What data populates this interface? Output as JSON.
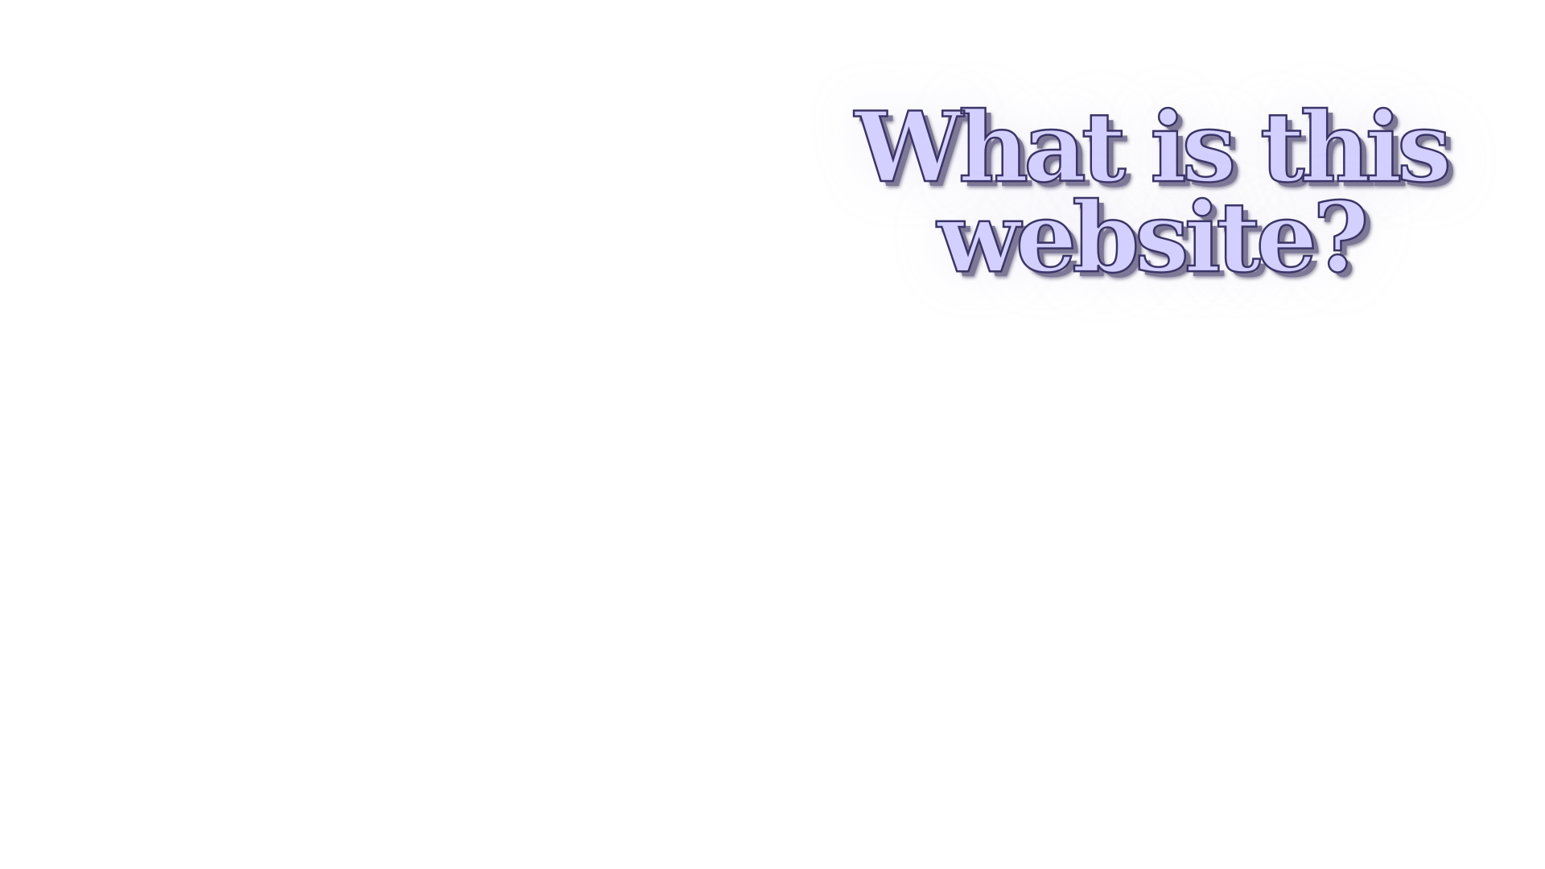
{
  "hero": {
    "heading_line_1": "What is this",
    "heading_line_2": "website?"
  },
  "colors": {
    "background": "#ffffff",
    "heading_fill": "#d3d0ff",
    "heading_outline": "#3a3566",
    "heading_shadow": "#7d7896"
  }
}
